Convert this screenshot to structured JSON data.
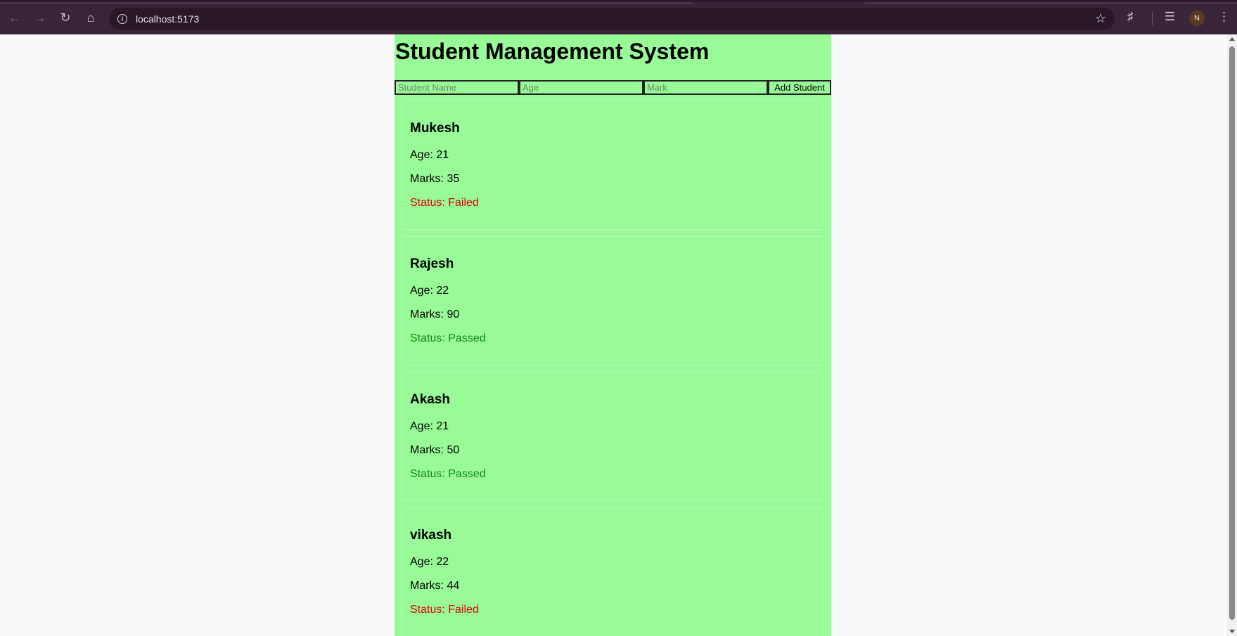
{
  "browser": {
    "url": "localhost:5173",
    "profile_initial": "N"
  },
  "app": {
    "title": "Student Management System",
    "form": {
      "name_placeholder": "Student Name",
      "age_placeholder": "Age",
      "mark_placeholder": "Mark",
      "submit_label": "Add Student"
    },
    "students": [
      {
        "name": "Mukesh",
        "age": "Age: 21",
        "marks": "Marks: 35",
        "status": "Status: Failed"
      },
      {
        "name": "Rajesh",
        "age": "Age: 22",
        "marks": "Marks: 90",
        "status": "Status: Passed"
      },
      {
        "name": "Akash",
        "age": "Age: 21",
        "marks": "Marks: 50",
        "status": "Status: Passed"
      },
      {
        "name": "vikash",
        "age": "Age: 22",
        "marks": "Marks: 44",
        "status": "Status: Failed"
      }
    ]
  },
  "colors": {
    "app_background": "#98fb98",
    "failed": "#e00000",
    "passed": "#118811"
  }
}
